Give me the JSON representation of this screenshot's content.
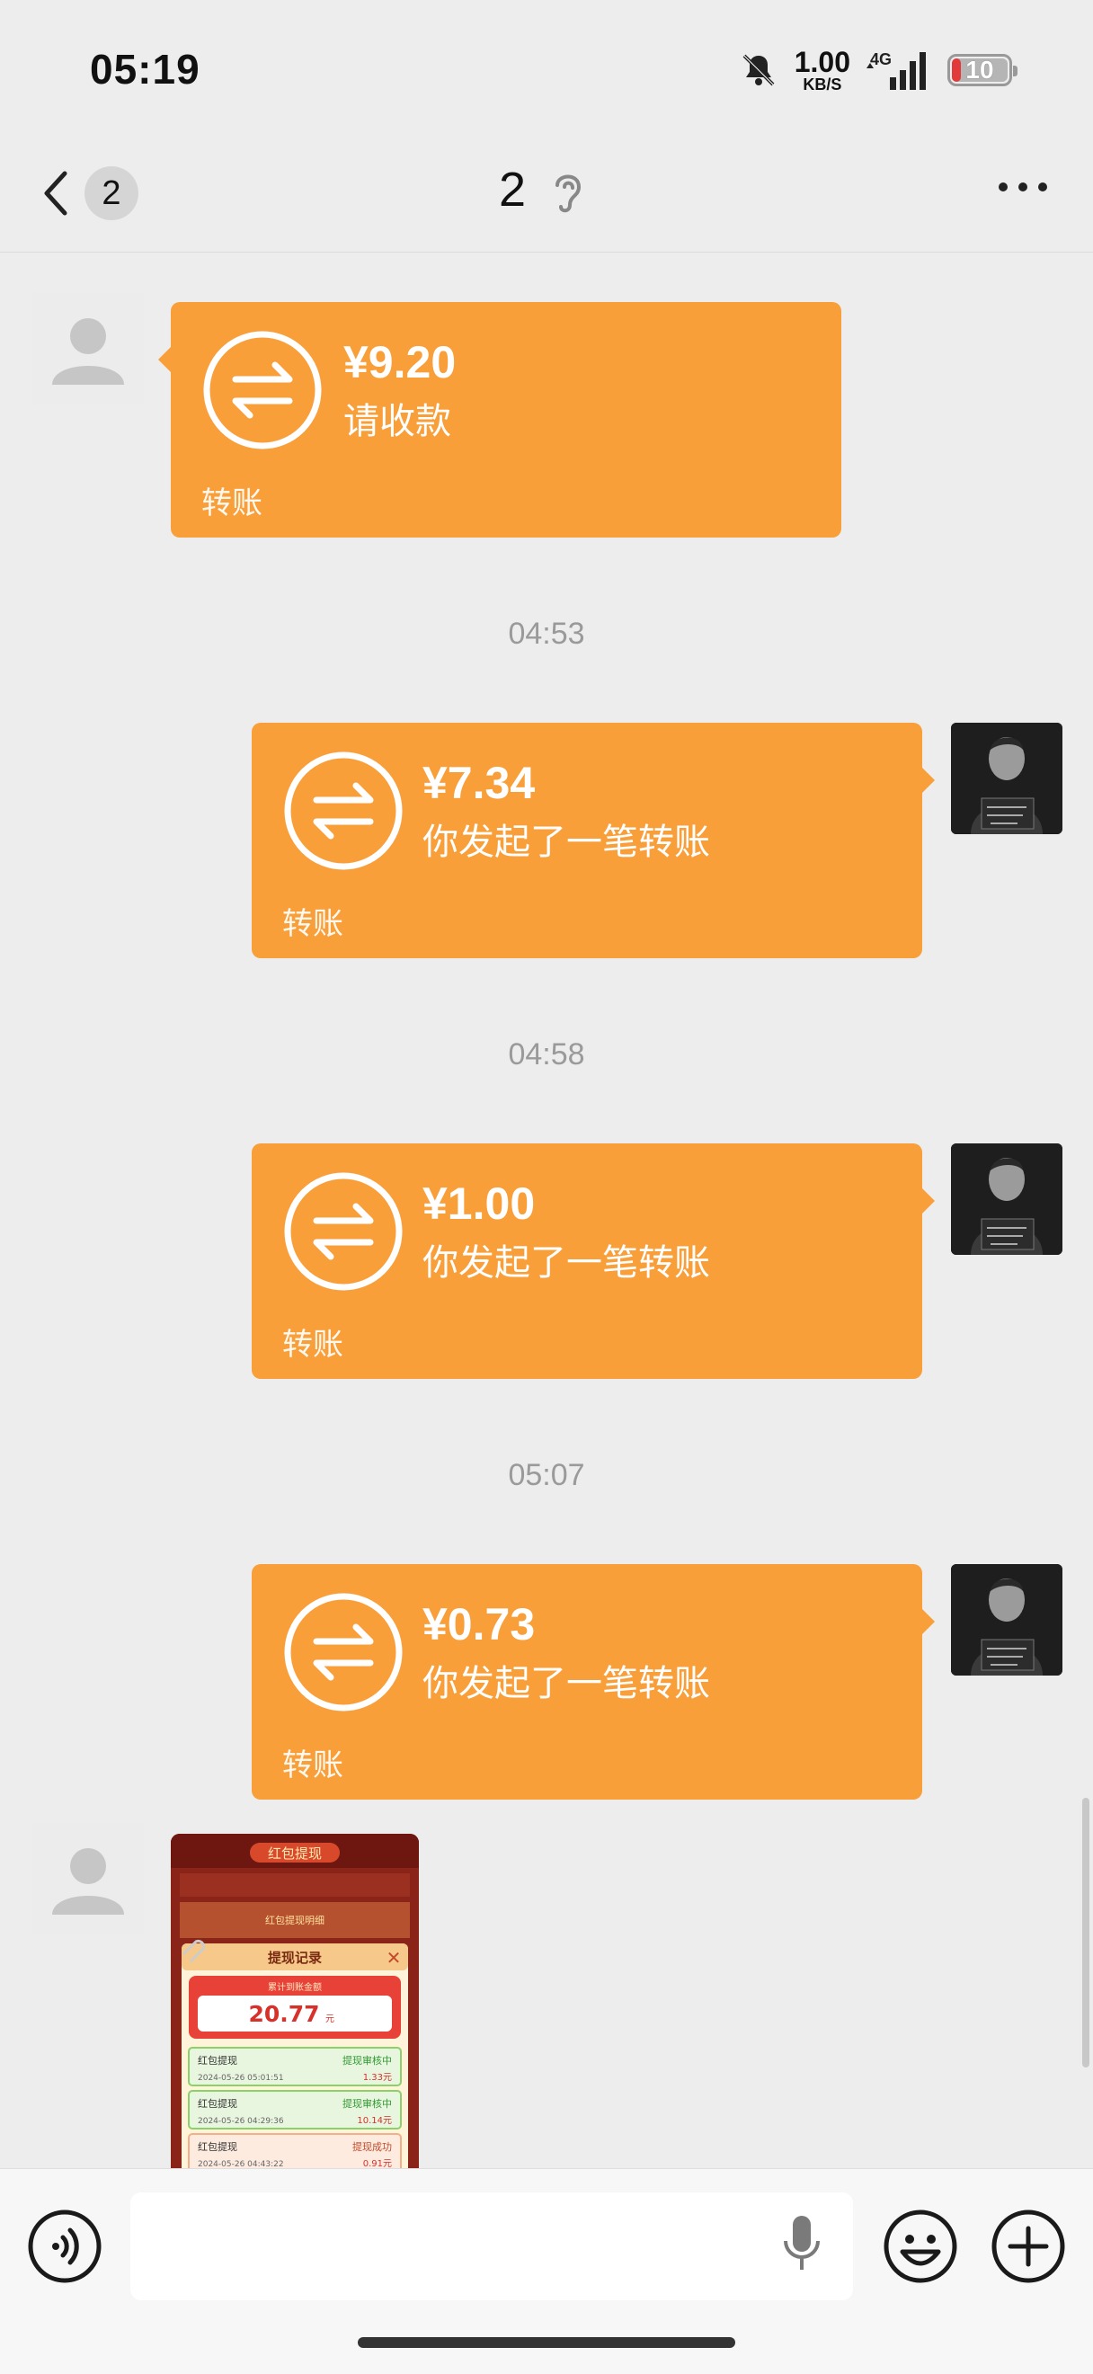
{
  "status_bar": {
    "time": "05:19",
    "speed_value": "1.00",
    "speed_unit": "KB/S",
    "network": "4G",
    "battery": "10"
  },
  "nav": {
    "unread_count": "2",
    "title": "2"
  },
  "messages": [
    {
      "side": "left",
      "amount": "¥9.20",
      "desc": "请收款",
      "kind": "转账"
    },
    {
      "timestamp": "04:53"
    },
    {
      "side": "right",
      "amount": "¥7.34",
      "desc": "你发起了一笔转账",
      "kind": "转账"
    },
    {
      "timestamp": "04:58"
    },
    {
      "side": "right",
      "amount": "¥1.00",
      "desc": "你发起了一笔转账",
      "kind": "转账"
    },
    {
      "timestamp": "05:07"
    },
    {
      "side": "right",
      "amount": "¥0.73",
      "desc": "你发起了一笔转账",
      "kind": "转账"
    }
  ],
  "image_message": {
    "header": "红包提现",
    "subheader": "红包提现明细",
    "panel_title": "提现记录",
    "total_label": "累计到账金额",
    "total_amount": "20.77",
    "total_unit": "元",
    "records": [
      {
        "title": "红包提现",
        "status": "提现审核中",
        "date": "2024-05-26 05:01:51",
        "amount": "1.33元"
      },
      {
        "title": "红包提现",
        "status": "提现审核中",
        "date": "2024-05-26 04:29:36",
        "amount": "10.14元"
      },
      {
        "title": "红包提现",
        "status": "提现成功",
        "date": "2024-05-26 04:43:22",
        "amount": "0.91元"
      }
    ]
  },
  "colors": {
    "transfer_bubble": "#f99f3a",
    "background": "#ededed"
  },
  "icons": [
    "back-chevron-icon",
    "ear-icon",
    "more-icon",
    "transfer-icon",
    "voice-icon",
    "mic-icon",
    "emoji-icon",
    "plus-icon"
  ]
}
